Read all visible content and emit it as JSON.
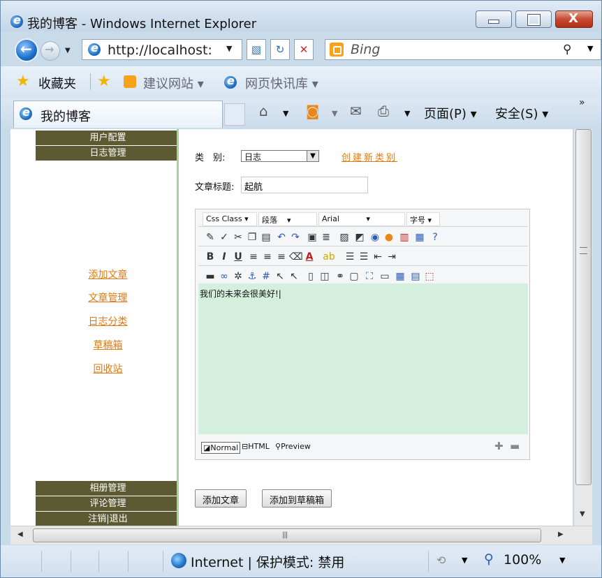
{
  "window": {
    "title": "我的博客 - Windows Internet Explorer",
    "minimize_glyph": "—",
    "maximize_glyph": "□",
    "close_glyph": "X"
  },
  "address_bar": {
    "url": "http://localhost:",
    "search_placeholder": "Bing"
  },
  "favorites_bar": {
    "favorites_label": "收藏夹",
    "items": [
      "建议网站 ▾",
      "网页快讯库 ▾"
    ]
  },
  "tab": {
    "label": "我的博客"
  },
  "command_bar": {
    "page_label": "页面(P)",
    "safety_label": "安全(S)"
  },
  "left_nav": {
    "top_headers": [
      "用户配置",
      "日志管理"
    ],
    "links": [
      "添加文章",
      "文章管理",
      "日志分类",
      "草稿箱",
      "回收站"
    ],
    "bottom_headers": [
      "相册管理",
      "评论管理",
      "注销|退出"
    ]
  },
  "form": {
    "category_label": "类　别:",
    "category_value": "日志",
    "create_category_link": "创建新类别",
    "title_label": "文章标题:",
    "title_value": "起航"
  },
  "editor": {
    "css_class": "Css Class",
    "paragraph": "段落",
    "font": "Arial",
    "font_size": "字号",
    "content": "我们的未来会很美好!|",
    "modes": [
      "Normal",
      "HTML",
      "Preview"
    ]
  },
  "buttons": {
    "add_article": "添加文章",
    "add_to_drafts": "添加到草稿箱"
  },
  "statusbar": {
    "zone_text": "Internet | 保护模式: 禁用",
    "zoom": "100%"
  },
  "colors": {
    "accent_green": "#5b5a32",
    "link_orange": "#e07b14",
    "editor_bg": "#d5efde",
    "panel_border": "#a6d49d"
  }
}
